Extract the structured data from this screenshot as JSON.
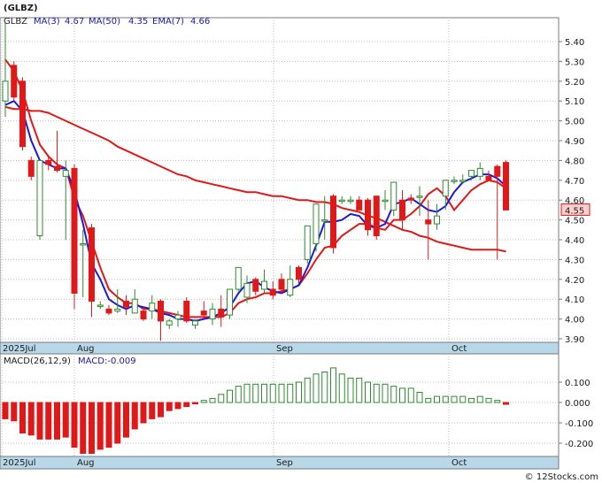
{
  "title": "(GLBZ)",
  "legend": {
    "symbol": "GLBZ",
    "items": [
      {
        "label": "MA(3)",
        "value": "4.67",
        "color": "#1a1ad8"
      },
      {
        "label": "MA(50)",
        "value": "4.35",
        "color": "#e01818"
      },
      {
        "label": "EMA(7)",
        "value": "4.66",
        "color": "#e01818"
      }
    ]
  },
  "macd_label": "MACD(26,12,9)",
  "macd_value_label": "MACD:-0.009",
  "last_price": "4.55",
  "watermark": "© 12Stocks.com",
  "colors": {
    "up": "#2e8b2e",
    "down": "#e01818",
    "ma_short": "#1a1ad8",
    "ma_long": "#e01818",
    "axis_band": "#b8d8ea"
  },
  "chart_data": [
    {
      "type": "candlestick",
      "x_labels": [
        "2025Jul",
        "Aug",
        "Sep",
        "Oct"
      ],
      "y_ticks": [
        "5.40",
        "5.30",
        "5.20",
        "5.10",
        "5.00",
        "4.90",
        "4.80",
        "4.70",
        "4.60",
        "4.50",
        "4.40",
        "4.30",
        "4.20",
        "4.10",
        "4.00",
        "3.90"
      ],
      "ylim": [
        3.85,
        5.55
      ],
      "candles": [
        [
          5.1,
          5.5,
          5.02,
          5.2
        ],
        [
          5.28,
          5.3,
          5.1,
          5.12
        ],
        [
          5.2,
          5.22,
          4.85,
          4.87
        ],
        [
          4.8,
          4.82,
          4.7,
          4.72
        ],
        [
          4.42,
          4.8,
          4.4,
          4.8
        ],
        [
          4.8,
          4.82,
          4.75,
          4.78
        ],
        [
          4.77,
          4.95,
          4.74,
          4.75
        ],
        [
          4.72,
          4.8,
          4.4,
          4.75
        ],
        [
          4.76,
          4.78,
          4.05,
          4.13
        ],
        [
          4.38,
          4.45,
          4.11,
          4.38
        ],
        [
          4.46,
          4.48,
          4.01,
          4.09
        ],
        [
          4.07,
          4.09,
          4.05,
          4.07
        ],
        [
          4.05,
          4.07,
          4.02,
          4.03
        ],
        [
          4.04,
          4.15,
          4.03,
          4.05
        ],
        [
          4.09,
          4.12,
          4.02,
          4.06
        ],
        [
          4.03,
          4.15,
          4.03,
          4.1
        ],
        [
          4.04,
          4.05,
          3.99,
          4.0
        ],
        [
          4.04,
          4.12,
          4.0,
          4.08
        ],
        [
          4.09,
          4.1,
          3.89,
          3.99
        ],
        [
          3.97,
          4.0,
          3.95,
          3.99
        ],
        [
          4.0,
          4.04,
          3.96,
          4.02
        ],
        [
          4.09,
          4.11,
          3.98,
          3.99
        ],
        [
          3.97,
          4.0,
          3.95,
          3.99
        ],
        [
          4.04,
          4.09,
          4.0,
          4.02
        ],
        [
          4.0,
          4.08,
          3.97,
          4.05
        ],
        [
          4.05,
          4.12,
          3.96,
          4.01
        ],
        [
          4.02,
          4.15,
          4.0,
          4.15
        ],
        [
          4.15,
          4.26,
          4.14,
          4.26
        ],
        [
          4.11,
          4.22,
          4.08,
          4.18
        ],
        [
          4.2,
          4.21,
          4.12,
          4.14
        ],
        [
          4.15,
          4.25,
          4.13,
          4.19
        ],
        [
          4.15,
          4.19,
          4.1,
          4.12
        ],
        [
          4.2,
          4.23,
          4.13,
          4.15
        ],
        [
          4.12,
          4.27,
          4.11,
          4.2
        ],
        [
          4.26,
          4.27,
          4.18,
          4.2
        ],
        [
          4.3,
          4.47,
          4.28,
          4.47
        ],
        [
          4.38,
          4.58,
          4.34,
          4.58
        ],
        [
          4.5,
          4.62,
          4.4,
          4.5
        ],
        [
          4.62,
          4.63,
          4.33,
          4.36
        ],
        [
          4.6,
          4.62,
          4.58,
          4.6
        ],
        [
          4.6,
          4.62,
          4.58,
          4.6
        ],
        [
          4.6,
          4.62,
          4.55,
          4.55
        ],
        [
          4.6,
          4.61,
          4.42,
          4.45
        ],
        [
          4.62,
          4.62,
          4.4,
          4.42
        ],
        [
          4.6,
          4.65,
          4.55,
          4.6
        ],
        [
          4.55,
          4.69,
          4.52,
          4.69
        ],
        [
          4.6,
          4.65,
          4.45,
          4.5
        ],
        [
          4.61,
          4.63,
          4.58,
          4.6
        ],
        [
          4.62,
          4.67,
          4.52,
          4.62
        ],
        [
          4.5,
          4.6,
          4.3,
          4.48
        ],
        [
          4.48,
          4.58,
          4.45,
          4.52
        ],
        [
          4.62,
          4.7,
          4.55,
          4.7
        ],
        [
          4.7,
          4.72,
          4.68,
          4.7
        ],
        [
          4.7,
          4.73,
          4.68,
          4.7
        ],
        [
          4.72,
          4.75,
          4.7,
          4.75
        ],
        [
          4.72,
          4.79,
          4.7,
          4.76
        ],
        [
          4.72,
          4.75,
          4.7,
          4.7
        ],
        [
          4.77,
          4.78,
          4.3,
          4.72
        ],
        [
          4.79,
          4.8,
          4.55,
          4.55
        ]
      ],
      "ma3": [
        5.08,
        5.1,
        5.05,
        4.9,
        4.8,
        4.78,
        4.76,
        4.76,
        4.65,
        4.48,
        4.28,
        4.2,
        4.1,
        4.07,
        4.05,
        4.07,
        4.06,
        4.05,
        4.03,
        4.02,
        4.0,
        4.0,
        3.99,
        4.0,
        4.01,
        4.03,
        4.06,
        4.13,
        4.18,
        4.19,
        4.16,
        4.14,
        4.13,
        4.15,
        4.17,
        4.26,
        4.37,
        4.49,
        4.49,
        4.5,
        4.53,
        4.52,
        4.47,
        4.46,
        4.48,
        4.58,
        4.59,
        4.61,
        4.58,
        4.55,
        4.54,
        4.57,
        4.64,
        4.69,
        4.71,
        4.73,
        4.73,
        4.71,
        4.67
      ],
      "ma50": [
        5.07,
        5.06,
        5.06,
        5.05,
        5.05,
        5.04,
        5.02,
        5.0,
        4.98,
        4.96,
        4.94,
        4.92,
        4.9,
        4.87,
        4.85,
        4.83,
        4.81,
        4.79,
        4.77,
        4.75,
        4.73,
        4.72,
        4.7,
        4.69,
        4.68,
        4.67,
        4.66,
        4.65,
        4.64,
        4.64,
        4.63,
        4.62,
        4.62,
        4.61,
        4.6,
        4.6,
        4.59,
        4.59,
        4.58,
        4.56,
        4.55,
        4.54,
        4.52,
        4.51,
        4.49,
        4.47,
        4.45,
        4.44,
        4.42,
        4.41,
        4.39,
        4.38,
        4.37,
        4.36,
        4.35,
        4.35,
        4.35,
        4.35,
        4.34
      ],
      "ema7": [
        5.31,
        5.25,
        5.15,
        5.0,
        4.88,
        4.82,
        4.78,
        4.76,
        4.61,
        4.52,
        4.39,
        4.26,
        4.15,
        4.11,
        4.08,
        4.08,
        4.05,
        4.05,
        4.04,
        4.03,
        4.02,
        4.01,
        4.01,
        4.01,
        4.01,
        4.01,
        4.03,
        4.08,
        4.1,
        4.11,
        4.13,
        4.13,
        4.14,
        4.15,
        4.17,
        4.23,
        4.3,
        4.36,
        4.37,
        4.42,
        4.45,
        4.48,
        4.48,
        4.46,
        4.45,
        4.5,
        4.5,
        4.53,
        4.57,
        4.63,
        4.66,
        4.62,
        4.55,
        4.6,
        4.65,
        4.68,
        4.7,
        4.69,
        4.66
      ],
      "last_value": 4.55
    },
    {
      "type": "bar",
      "title": "MACD(26,12,9)",
      "y_ticks": [
        "0.100",
        "0.000",
        "-0.100",
        "-0.200"
      ],
      "ylim": [
        -0.26,
        0.17
      ],
      "values": [
        -0.08,
        -0.09,
        -0.15,
        -0.16,
        -0.18,
        -0.18,
        -0.18,
        -0.17,
        -0.22,
        -0.25,
        -0.25,
        -0.23,
        -0.22,
        -0.2,
        -0.17,
        -0.13,
        -0.1,
        -0.08,
        -0.07,
        -0.04,
        -0.03,
        -0.02,
        -0.005,
        0.01,
        0.02,
        0.04,
        0.06,
        0.08,
        0.09,
        0.09,
        0.09,
        0.09,
        0.09,
        0.09,
        0.1,
        0.12,
        0.14,
        0.15,
        0.17,
        0.14,
        0.12,
        0.12,
        0.1,
        0.09,
        0.09,
        0.08,
        0.07,
        0.07,
        0.05,
        0.02,
        0.03,
        0.03,
        0.03,
        0.03,
        0.02,
        0.03,
        0.02,
        0.01,
        -0.009
      ]
    }
  ]
}
